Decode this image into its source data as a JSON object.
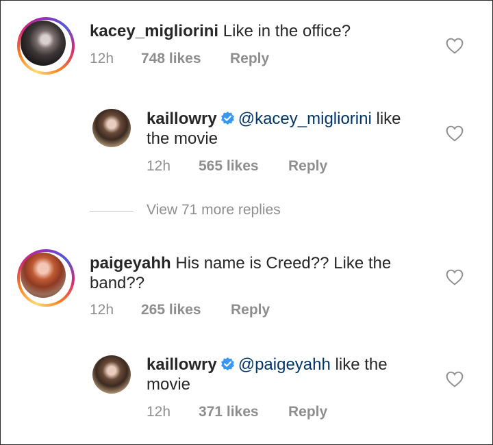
{
  "comments": [
    {
      "username": "kacey_migliorini",
      "text": "Like in the office?",
      "time": "12h",
      "likes": "748 likes",
      "reply": "Reply"
    },
    {
      "username": "kaillowry",
      "mention": "@kacey_migliorini",
      "text_line1_rest": " like",
      "text_line2": "the movie",
      "time": "12h",
      "likes": "565 likes",
      "reply": "Reply"
    },
    {
      "username": "paigeyahh",
      "text_line1": "His name is Creed?? Like the",
      "text_line2": "band??",
      "time": "12h",
      "likes": "265 likes",
      "reply": "Reply"
    },
    {
      "username": "kaillowry",
      "mention": "@paigeyahh",
      "text_line1_rest": " like the",
      "text_line2": "movie",
      "time": "12h",
      "likes": "371 likes",
      "reply": "Reply"
    }
  ],
  "view_more": {
    "label": "View 71 more replies"
  },
  "icons": {
    "heart": "heart-outline-icon",
    "verified": "verified-badge-icon"
  },
  "colors": {
    "text": "#262626",
    "meta": "#8e8e8e",
    "mention": "#003569",
    "verified": "#3897f0"
  }
}
